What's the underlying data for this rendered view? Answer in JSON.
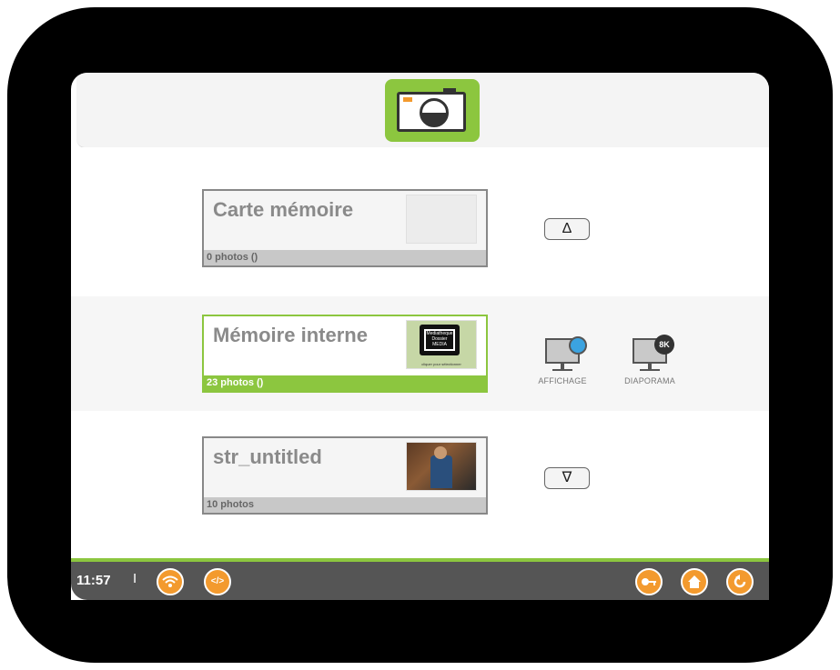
{
  "header": {
    "icon": "camera-icon"
  },
  "sources": [
    {
      "title": "Carte mémoire",
      "count": "0 photos ()"
    },
    {
      "title": "Mémoire interne",
      "count": "23 photos ()",
      "poster_lines": [
        "Mediatheque",
        "Dossier",
        "MEDIA"
      ],
      "poster_caption": "cliquer pour sélectionner"
    },
    {
      "title": "str_untitled",
      "count": "10 photos"
    }
  ],
  "scroll_up": "Δ",
  "scroll_down": "∇",
  "actions": {
    "display_label": "AFFICHAGE",
    "slideshow_label": "DIAPORAMA",
    "slideshow_badge": "8K"
  },
  "status": {
    "time": "11:57",
    "separator": "I",
    "wifi_icon": "wifi-icon",
    "code_icon": "code-icon",
    "key_icon": "key-icon",
    "home_icon": "home-icon",
    "back_icon": "back-icon"
  },
  "colors": {
    "accent": "#8cc63f",
    "orange": "#f39a2e",
    "bar": "#555555"
  }
}
